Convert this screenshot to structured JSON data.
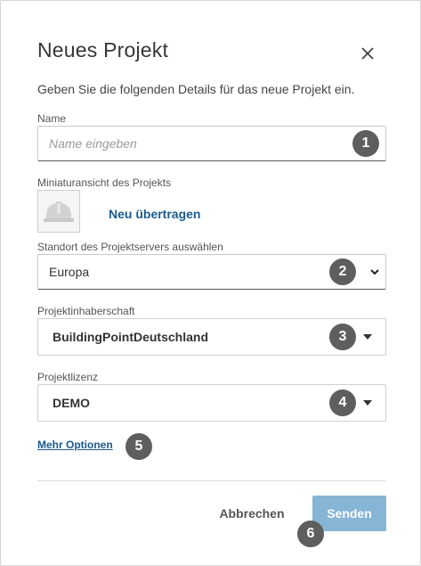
{
  "dialog": {
    "title": "Neues Projekt",
    "subtitle": "Geben Sie die folgenden Details für das neue Projekt ein."
  },
  "name_field": {
    "label": "Name",
    "placeholder": "Name eingeben",
    "value": ""
  },
  "thumbnail": {
    "label": "Miniaturansicht des Projekts",
    "upload_label": "Neu übertragen",
    "icon": "hard-hat-icon"
  },
  "server_location": {
    "label": "Standort des Projektservers auswählen",
    "value": "Europa",
    "icon": "chevron-down-icon"
  },
  "ownership": {
    "label": "Projektinhaberschaft",
    "value": "BuildingPointDeutschland",
    "icon": "caret-down-icon"
  },
  "license": {
    "label": "Projektlizenz",
    "value": "DEMO",
    "icon": "caret-down-icon"
  },
  "more_options": "Mehr Optionen",
  "actions": {
    "cancel_label": "Abbrechen",
    "submit_label": "Senden"
  },
  "callouts": [
    "1",
    "2",
    "3",
    "4",
    "5",
    "6"
  ],
  "colors": {
    "link": "#1a5a8f",
    "submit_bg": "#86b5d6",
    "badge": "#5e5e5e"
  }
}
